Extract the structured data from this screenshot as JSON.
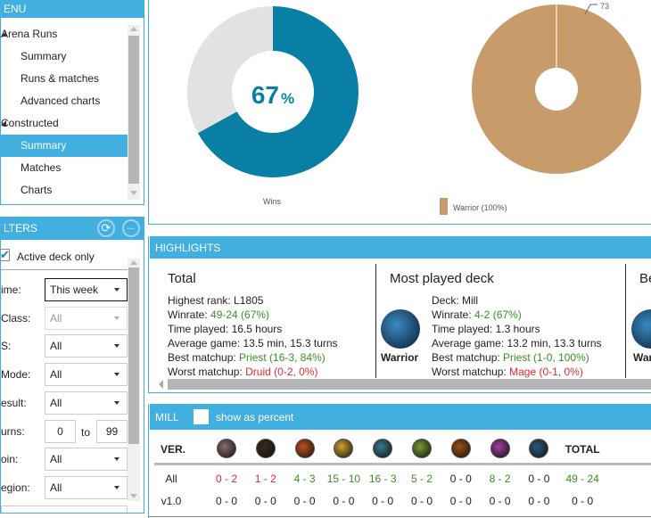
{
  "menu": {
    "title": "ENU",
    "items": [
      {
        "label": "Arena Runs",
        "type": "group"
      },
      {
        "label": "Summary",
        "type": "sub"
      },
      {
        "label": "Runs & matches",
        "type": "sub"
      },
      {
        "label": "Advanced charts",
        "type": "sub"
      },
      {
        "label": "Constructed",
        "type": "group"
      },
      {
        "label": "Summary",
        "type": "sub",
        "selected": true
      },
      {
        "label": "Matches",
        "type": "sub"
      },
      {
        "label": "Charts",
        "type": "sub"
      }
    ]
  },
  "filters": {
    "title": "LTERS",
    "refresh_icon": "refresh-icon",
    "more_label": "...",
    "active_deck_label": "Active deck only",
    "active_deck_checked": true,
    "rows": [
      {
        "label": "ime:",
        "value": "This week",
        "focused": true
      },
      {
        "label": "Class:",
        "value": "All",
        "disabled": true
      },
      {
        "label": "S:",
        "value": "All"
      },
      {
        "label": "Mode:",
        "value": "All"
      },
      {
        "label": "esult:",
        "value": "All"
      },
      {
        "label": "urns:",
        "from": "0",
        "to_label": "to",
        "to": "99"
      },
      {
        "label": "oin:",
        "value": "All"
      },
      {
        "label": "egion:",
        "value": "All"
      }
    ]
  },
  "charts": {
    "colors": {
      "wins": "#0a7fa6",
      "losses": "#e2e2e2",
      "warrior": "#c89b6b",
      "accent": "#41b0e1"
    },
    "winrate": {
      "percent": 67,
      "value_label": "67",
      "unit": "%",
      "legend": "Wins"
    },
    "classes": {
      "slices": [
        {
          "name": "Warrior",
          "value": 73
        }
      ],
      "label": "73",
      "legend": "Warrior (100%)"
    }
  },
  "highlights": {
    "title": "HIGHLIGHTS",
    "total": {
      "title": "Total",
      "rank_label": "Highest rank: ",
      "rank": "L1805",
      "winrate_label": "Winrate: ",
      "winrate": "49-24 (67%)",
      "time": "Time played: 16.5 hours",
      "avg": "Average game: 13.5 min, 15.3 turns",
      "best_label": "Best matchup: ",
      "best": "Priest (16-3, 84%)",
      "worst_label": "Worst matchup: ",
      "worst": "Druid (0-2, 0%)"
    },
    "most_played": {
      "title": "Most played deck",
      "class": "Warrior",
      "deck": "Deck: Mill",
      "winrate_label": "Winrate: ",
      "winrate": "4-2 (67%)",
      "time": "Time played: 1.3 hours",
      "avg": "Average game: 13.2 min, 13.3 turns",
      "best_label": "Best matchup: ",
      "best": "Priest (1-0, 100%)",
      "worst_label": "Worst matchup: ",
      "worst": "Mage (0-1, 0%)"
    },
    "third": {
      "title": "Be",
      "class": "War"
    }
  },
  "deck_table": {
    "title": "MILL",
    "percent_label": "show as percent",
    "ver_header": "VER.",
    "total_header": "TOTAL",
    "class_icons": [
      {
        "name": "druid",
        "color": "#8a6a70"
      },
      {
        "name": "hunter",
        "color": "#3a2a1a"
      },
      {
        "name": "mage",
        "color": "#c0501a"
      },
      {
        "name": "paladin",
        "color": "#d0a030"
      },
      {
        "name": "priest",
        "color": "#3a7a90"
      },
      {
        "name": "rogue",
        "color": "#7a9a30"
      },
      {
        "name": "shaman",
        "color": "#a05010"
      },
      {
        "name": "warlock",
        "color": "#a040a0"
      },
      {
        "name": "warrior",
        "color": "#2a5a80"
      }
    ],
    "rows": [
      {
        "ver": "All",
        "cells": [
          {
            "v": "0 - 2",
            "c": "r"
          },
          {
            "v": "1 - 2",
            "c": "r"
          },
          {
            "v": "4 - 3",
            "c": "g"
          },
          {
            "v": "15 - 10",
            "c": "g"
          },
          {
            "v": "16 - 3",
            "c": "g"
          },
          {
            "v": "5 - 2",
            "c": "g"
          },
          {
            "v": "0 - 0",
            "c": ""
          },
          {
            "v": "8 - 2",
            "c": "g"
          },
          {
            "v": "0 - 0",
            "c": ""
          }
        ],
        "total": "49 - 24",
        "total_c": "g"
      },
      {
        "ver": "v1.0",
        "cells": [
          {
            "v": "0 - 0",
            "c": ""
          },
          {
            "v": "0 - 0",
            "c": ""
          },
          {
            "v": "0 - 0",
            "c": ""
          },
          {
            "v": "0 - 0",
            "c": ""
          },
          {
            "v": "0 - 0",
            "c": ""
          },
          {
            "v": "0 - 0",
            "c": ""
          },
          {
            "v": "0 - 0",
            "c": ""
          },
          {
            "v": "0 - 0",
            "c": ""
          },
          {
            "v": "0 - 0",
            "c": ""
          }
        ],
        "total": "0 - 0",
        "total_c": ""
      }
    ]
  }
}
